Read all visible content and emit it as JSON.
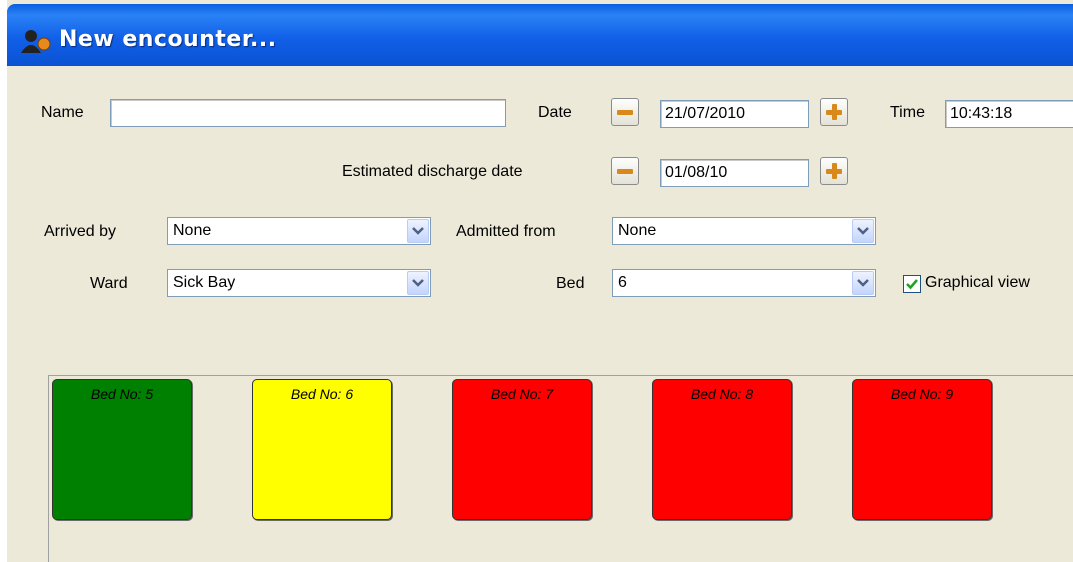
{
  "window": {
    "title": "New encounter..."
  },
  "form": {
    "name_label": "Name",
    "name_value": "",
    "date_label": "Date",
    "date_value": "21/07/2010",
    "time_label": "Time",
    "time_value": "10:43:18",
    "discharge_label": "Estimated discharge date",
    "discharge_value": "01/08/10",
    "arrived_by_label": "Arrived by",
    "arrived_by_value": "None",
    "admitted_from_label": "Admitted from",
    "admitted_from_value": "None",
    "ward_label": "Ward",
    "ward_value": "Sick Bay",
    "bed_label": "Bed",
    "bed_value": "6",
    "graphical_view_label": "Graphical view",
    "graphical_view_checked": true
  },
  "beds": [
    {
      "label": "Bed No: 5",
      "status_color": "#008000"
    },
    {
      "label": "Bed No: 6",
      "status_color": "#ffff00"
    },
    {
      "label": "Bed No: 7",
      "status_color": "#ff0000"
    },
    {
      "label": "Bed No: 8",
      "status_color": "#ff0000"
    },
    {
      "label": "Bed No: 9",
      "status_color": "#ff0000"
    }
  ]
}
